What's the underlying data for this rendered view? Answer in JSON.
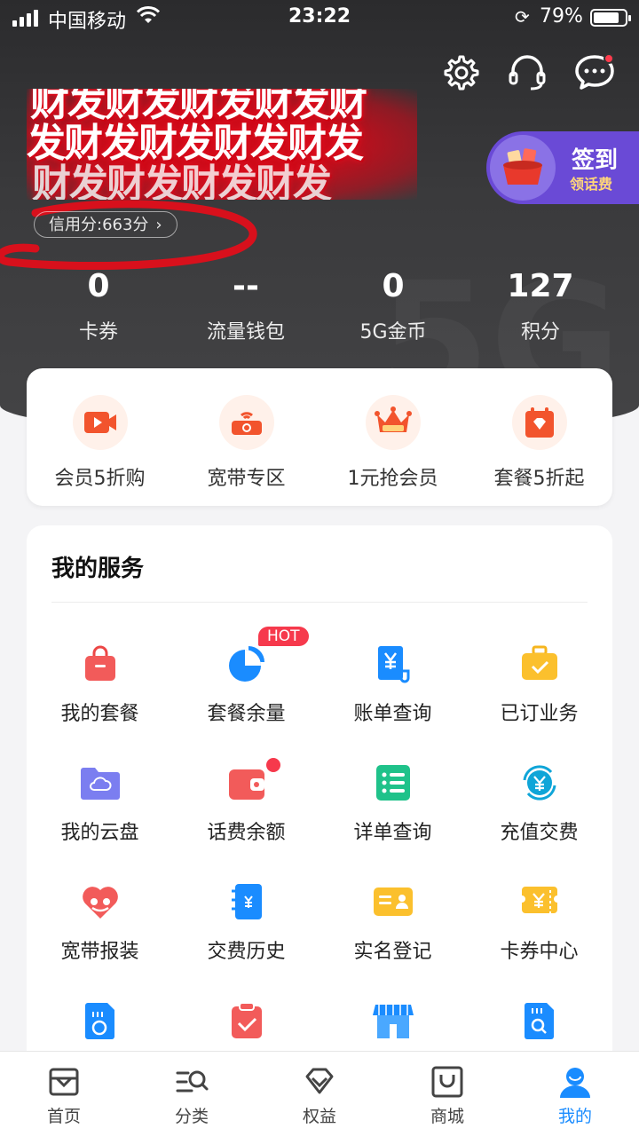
{
  "status_bar": {
    "carrier": "中国移动",
    "time": "23:22",
    "battery": "79%"
  },
  "header": {
    "scribble_text": [
      "财发财发财发财发财",
      "发财发财发财发财发",
      "财发财发财发财发"
    ],
    "credit": "信用分:663分",
    "credit_chevron": "›",
    "signin_title": "签到",
    "signin_sub": "领话费",
    "watermark": "5G"
  },
  "stats": [
    {
      "value": "0",
      "label": "卡券"
    },
    {
      "value": "--",
      "label": "流量钱包"
    },
    {
      "value": "0",
      "label": "5G金币"
    },
    {
      "value": "127",
      "label": "积分"
    }
  ],
  "promos": [
    {
      "label": "会员5折购",
      "icon": "video-icon"
    },
    {
      "label": "宽带专区",
      "icon": "router-icon"
    },
    {
      "label": "1元抢会员",
      "icon": "crown-icon"
    },
    {
      "label": "套餐5折起",
      "icon": "calendar-gem-icon"
    }
  ],
  "services": {
    "title": "我的服务",
    "hot_badge": "HOT",
    "items": [
      {
        "label": "我的套餐",
        "icon": "bag-icon"
      },
      {
        "label": "套餐余量",
        "icon": "pie-icon"
      },
      {
        "label": "账单查询",
        "icon": "bill-icon"
      },
      {
        "label": "已订业务",
        "icon": "briefcase-icon"
      },
      {
        "label": "我的云盘",
        "icon": "cloud-folder-icon"
      },
      {
        "label": "话费余额",
        "icon": "wallet-icon"
      },
      {
        "label": "详单查询",
        "icon": "list-icon"
      },
      {
        "label": "充值交费",
        "icon": "yuan-refresh-icon"
      },
      {
        "label": "宽带报装",
        "icon": "heart-icon"
      },
      {
        "label": "交费历史",
        "icon": "notebook-icon"
      },
      {
        "label": "实名登记",
        "icon": "id-card-icon"
      },
      {
        "label": "卡券中心",
        "icon": "ticket-icon"
      },
      {
        "label": "",
        "icon": "sim-icon"
      },
      {
        "label": "",
        "icon": "clipboard-icon"
      },
      {
        "label": "",
        "icon": "store-icon"
      },
      {
        "label": "",
        "icon": "sd-search-icon"
      }
    ]
  },
  "tabs": [
    {
      "label": "首页",
      "icon": "home-icon"
    },
    {
      "label": "分类",
      "icon": "category-icon"
    },
    {
      "label": "权益",
      "icon": "diamond-icon"
    },
    {
      "label": "商城",
      "icon": "shop-icon"
    },
    {
      "label": "我的",
      "icon": "user-icon"
    }
  ],
  "colors": {
    "accent": "#1a8cff",
    "hot": "#f6394c",
    "signin": "#6a4ad6"
  }
}
